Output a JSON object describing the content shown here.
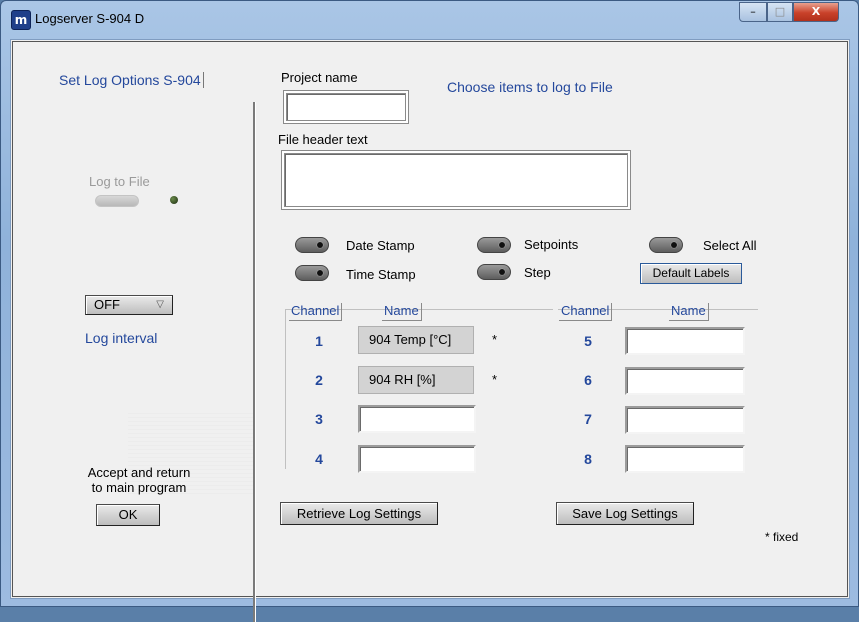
{
  "window": {
    "title": "Logserver S-904 D",
    "icon_letter": "m",
    "controls": {
      "minimize": "–",
      "maximize": "□",
      "close": "X"
    }
  },
  "left_panel": {
    "header": "Set Log Options S-904",
    "log_to_file_label": "Log to File",
    "log_to_file_state": "off",
    "interval_value": "OFF",
    "interval_label": "Log interval",
    "accept_text_line1": "Accept and return",
    "accept_text_line2": "to main program",
    "ok_label": "OK"
  },
  "right_panel": {
    "project_name_label": "Project name",
    "project_name_value": "",
    "choose_items_label": "Choose items to log to File",
    "file_header_label": "File header text",
    "file_header_value": "",
    "options": [
      {
        "label": "Date Stamp"
      },
      {
        "label": "Time Stamp"
      },
      {
        "label": "Setpoints"
      },
      {
        "label": "Step"
      },
      {
        "label": "Select All"
      }
    ],
    "default_labels_button": "Default Labels",
    "channel_header": "Channel",
    "name_header": "Name",
    "channels": [
      {
        "num": "1",
        "name": "904 Temp [°C]",
        "fixed": "*"
      },
      {
        "num": "2",
        "name": "904 RH [%]",
        "fixed": "*"
      },
      {
        "num": "3",
        "name": ""
      },
      {
        "num": "4",
        "name": ""
      },
      {
        "num": "5",
        "name": ""
      },
      {
        "num": "6",
        "name": ""
      },
      {
        "num": "7",
        "name": ""
      },
      {
        "num": "8",
        "name": ""
      }
    ],
    "retrieve_button": "Retrieve Log Settings",
    "save_button": "Save Log Settings",
    "fixed_note": "* fixed"
  },
  "colors": {
    "accent_blue": "#24489c",
    "titlebar": "#9dbbe0",
    "close_red": "#c9412a",
    "panel_bg": "#f0f0f0"
  }
}
